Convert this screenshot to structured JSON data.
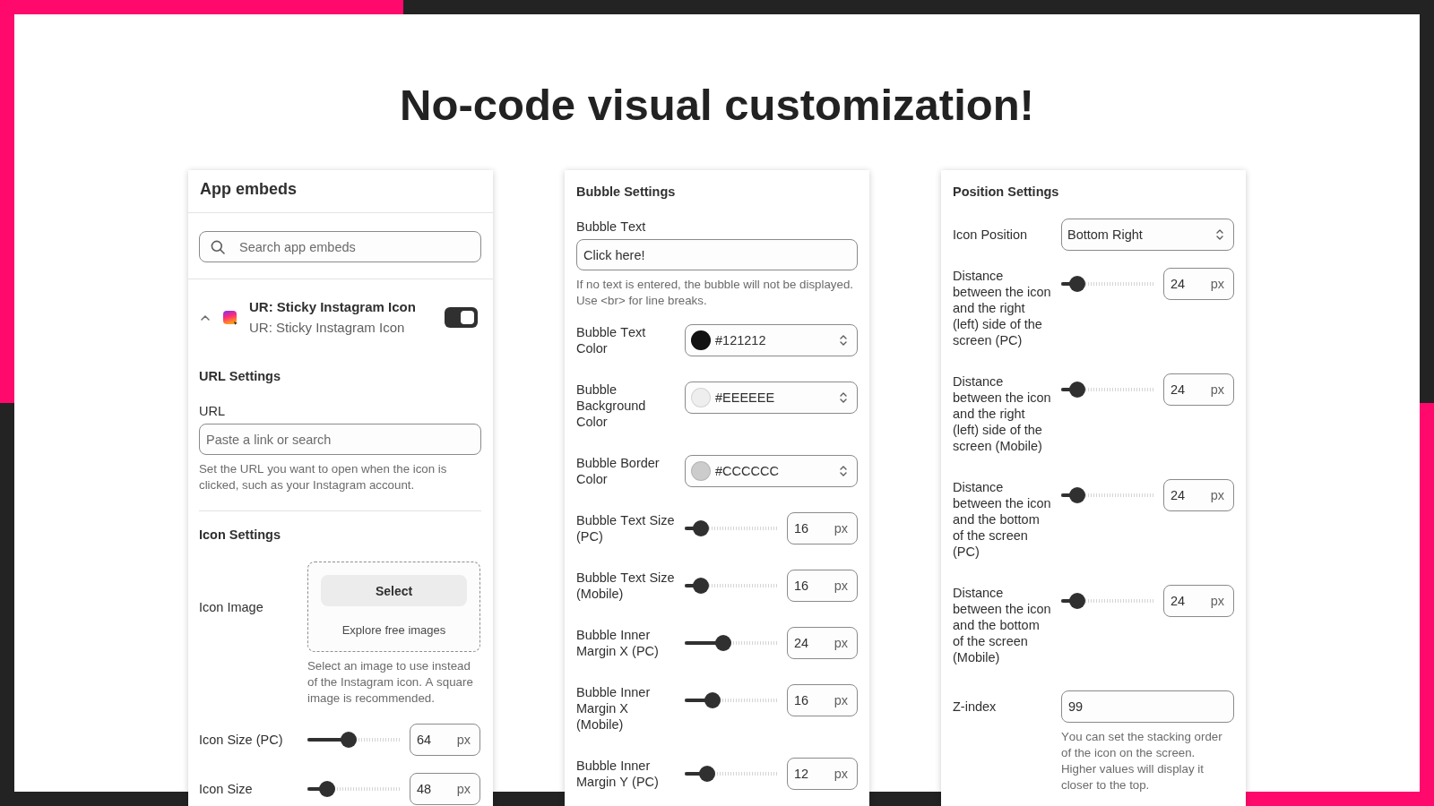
{
  "heading": "No-code visual customization!",
  "panels": [
    {
      "kind": "app_embeds",
      "title": "App embeds",
      "search": {
        "placeholder": "Search app embeds"
      },
      "embed": {
        "title": "UR: Sticky Instagram Icon",
        "subtitle": "UR: Sticky Instagram Icon",
        "expanded": true,
        "on": true
      },
      "sections": [
        {
          "title": "URL Settings",
          "fields": [
            {
              "kind": "text",
              "label": "URL",
              "placeholder": "Paste a link or search",
              "help": "Set the URL you want to open when the icon is clicked, such as your Instagram account."
            }
          ]
        },
        {
          "title": "Icon Settings",
          "fields": [
            {
              "kind": "image",
              "label": "Icon Image",
              "button": "Select",
              "link": "Explore free images",
              "help": "Select an image to use instead of the Instagram icon. A square image is recommended."
            },
            {
              "kind": "slider",
              "label": "Icon Size (PC)",
              "level": 0.44,
              "value": "64",
              "unit": "px"
            },
            {
              "kind": "slider",
              "label": "Icon Size",
              "level": 0.21,
              "value": "48",
              "unit": "px"
            }
          ]
        }
      ]
    },
    {
      "kind": "settings",
      "title": "Bubble Settings",
      "fields": [
        {
          "kind": "text",
          "label": "Bubble Text",
          "value": "Click here!",
          "help": "If no text is entered, the bubble will not be displayed. Use <br> for line breaks."
        },
        {
          "kind": "color",
          "label": "Bubble Text Color",
          "value": "#121212",
          "color": "#121212"
        },
        {
          "kind": "color",
          "label": "Bubble Background Color",
          "value": "#EEEEEE",
          "color": "#eeeeee"
        },
        {
          "kind": "color",
          "label": "Bubble Border Color",
          "value": "#CCCCCC",
          "color": "#cccccc"
        },
        {
          "kind": "slider",
          "label": "Bubble Text Size (PC)",
          "level": 0.17,
          "value": "16",
          "unit": "px"
        },
        {
          "kind": "slider",
          "label": "Bubble Text Size (Mobile)",
          "level": 0.17,
          "value": "16",
          "unit": "px"
        },
        {
          "kind": "slider",
          "label": "Bubble Inner Margin X (PC)",
          "level": 0.41,
          "value": "24",
          "unit": "px"
        },
        {
          "kind": "slider",
          "label": "Bubble Inner Margin X (Mobile)",
          "level": 0.3,
          "value": "16",
          "unit": "px"
        },
        {
          "kind": "slider",
          "label": "Bubble Inner Margin Y (PC)",
          "level": 0.24,
          "value": "12",
          "unit": "px"
        }
      ]
    },
    {
      "kind": "settings",
      "title": "Position Settings",
      "fields": [
        {
          "kind": "select",
          "label": "Icon Position",
          "value": "Bottom Right"
        },
        {
          "kind": "slider",
          "label": "Distance between the icon and the right (left) side of the screen (PC)",
          "level": 0.17,
          "value": "24",
          "unit": "px"
        },
        {
          "kind": "slider",
          "label": "Distance between the icon and the right (left) side of the screen (Mobile)",
          "level": 0.17,
          "value": "24",
          "unit": "px"
        },
        {
          "kind": "slider",
          "label": "Distance between the icon and the bottom of the screen (PC)",
          "level": 0.17,
          "value": "24",
          "unit": "px"
        },
        {
          "kind": "slider",
          "label": "Distance between the icon and the bottom of the screen (Mobile)",
          "level": 0.17,
          "value": "24",
          "unit": "px"
        },
        {
          "kind": "number",
          "label": "Z-index",
          "value": "99",
          "help": "You can set the stacking order of the icon on the screen. Higher values will display it closer to the top."
        }
      ]
    }
  ]
}
